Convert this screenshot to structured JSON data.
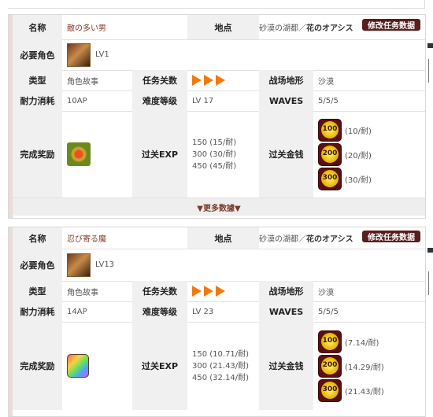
{
  "labels": {
    "name": "名称",
    "location": "地点",
    "required": "必要角色",
    "type": "类型",
    "quest_count": "任务关数",
    "terrain": "战场地形",
    "stamina": "耐力消耗",
    "difficulty": "难度等级",
    "waves": "WAVES",
    "reward": "完成奖励",
    "exp": "过关EXP",
    "gold": "过关金钱",
    "edit": "修改任务数据",
    "more": "▼更多数據▼"
  },
  "quests": [
    {
      "name": "敵の多い男",
      "location_prefix": "砂漠の湖都／",
      "location_main": "花のオアシス",
      "character_level": "LV1",
      "type": "角色故事",
      "terrain": "沙漠",
      "stamina": "10AP",
      "difficulty": "LV 17",
      "waves": "5/5/5",
      "reward_icon": "emblem-icon",
      "exp": [
        "150 (15/耐)",
        "300 (30/耐)",
        "450 (45/耐)"
      ],
      "gold": [
        {
          "coin": "100",
          "rate": "(10/耐)"
        },
        {
          "coin": "200",
          "rate": "(20/耐)"
        },
        {
          "coin": "300",
          "rate": "(30/耐)"
        }
      ]
    },
    {
      "name": "忍び寄る魔",
      "location_prefix": "砂漠の湖都／",
      "location_main": "花のオアシス",
      "character_level": "LV13",
      "type": "角色故事",
      "terrain": "沙漠",
      "stamina": "14AP",
      "difficulty": "LV 23",
      "waves": "5/5/5",
      "reward_icon": "rainbow-crystal-icon",
      "exp": [
        "150 (10.71/耐)",
        "300 (21.43/耐)",
        "450 (32.14/耐)"
      ],
      "gold": [
        {
          "coin": "100",
          "rate": "(7.14/耐)"
        },
        {
          "coin": "200",
          "rate": "(14.29/耐)"
        },
        {
          "coin": "300",
          "rate": "(21.43/耐)"
        }
      ]
    }
  ]
}
